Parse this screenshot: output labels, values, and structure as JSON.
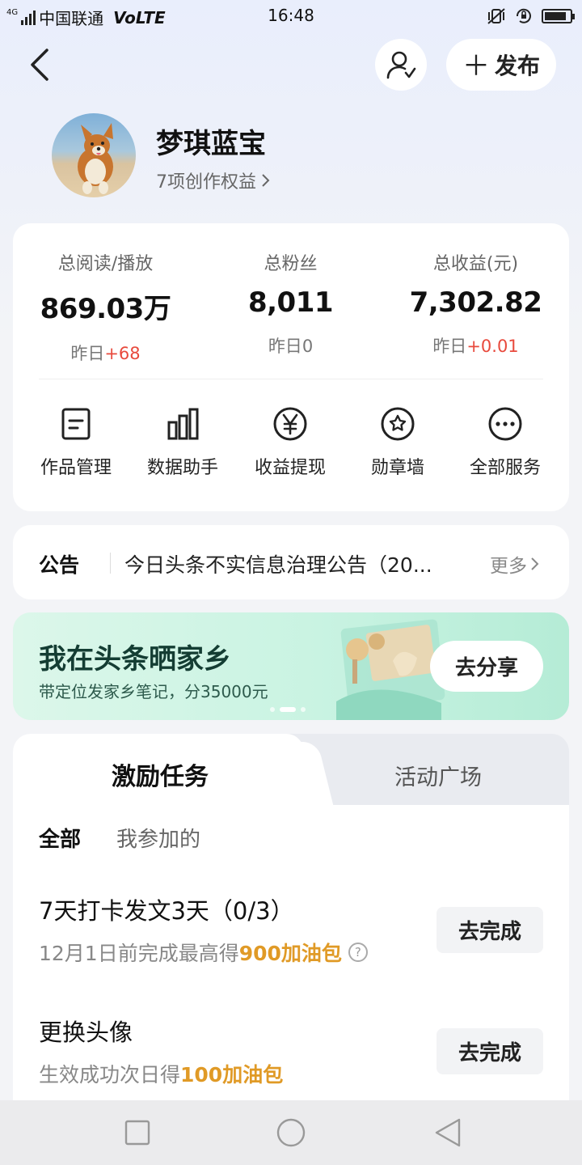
{
  "status_bar": {
    "network_badge": "4G",
    "carrier": "中国联通",
    "volte": "VoLTE",
    "time": "16:48",
    "battery_level": 0.85
  },
  "header": {
    "back_icon": "chevron-left-icon",
    "profile_icon": "user-check-icon",
    "publish_label": "发布"
  },
  "profile": {
    "name": "梦琪蓝宝",
    "rights_link": "7项创作权益"
  },
  "stats": [
    {
      "label": "总阅读/播放",
      "value": "869.03万",
      "delta_prefix": "昨日",
      "delta": "+68"
    },
    {
      "label": "总粉丝",
      "value": "8,011",
      "delta_prefix": "昨日",
      "delta": "0"
    },
    {
      "label": "总收益(元)",
      "value": "7,302.82",
      "delta_prefix": "昨日",
      "delta": "+0.01"
    }
  ],
  "tools": [
    {
      "label": "作品管理",
      "icon": "document-icon"
    },
    {
      "label": "数据助手",
      "icon": "bar-chart-icon"
    },
    {
      "label": "收益提现",
      "icon": "yuan-circle-icon"
    },
    {
      "label": "勋章墙",
      "icon": "medal-icon"
    },
    {
      "label": "全部服务",
      "icon": "more-circle-icon"
    }
  ],
  "notice": {
    "title": "公告",
    "text": "今日头条不实信息治理公告（20...",
    "more": "更多"
  },
  "banner": {
    "title": "我在头条晒家乡",
    "subtitle": "带定位发家乡笔记，分35000元",
    "button": "去分享",
    "page_count": 3,
    "active_page": 2
  },
  "tasks": {
    "tabs": [
      "激励任务",
      "活动广场"
    ],
    "filters": [
      "全部",
      "我参加的"
    ],
    "items": [
      {
        "title": "7天打卡发文3天（0/3）",
        "sub_prefix": "12月1日前完成最高得",
        "reward": "900加油包",
        "has_help": true,
        "button": "去完成"
      },
      {
        "title": "更换头像",
        "sub_prefix": "生效成功次日得",
        "reward": "100加油包",
        "has_help": false,
        "button": "去完成"
      }
    ]
  },
  "colors": {
    "accent_red": "#e84a3d",
    "reward_gold": "#e09a26",
    "banner_green": "#c9f3e2"
  }
}
